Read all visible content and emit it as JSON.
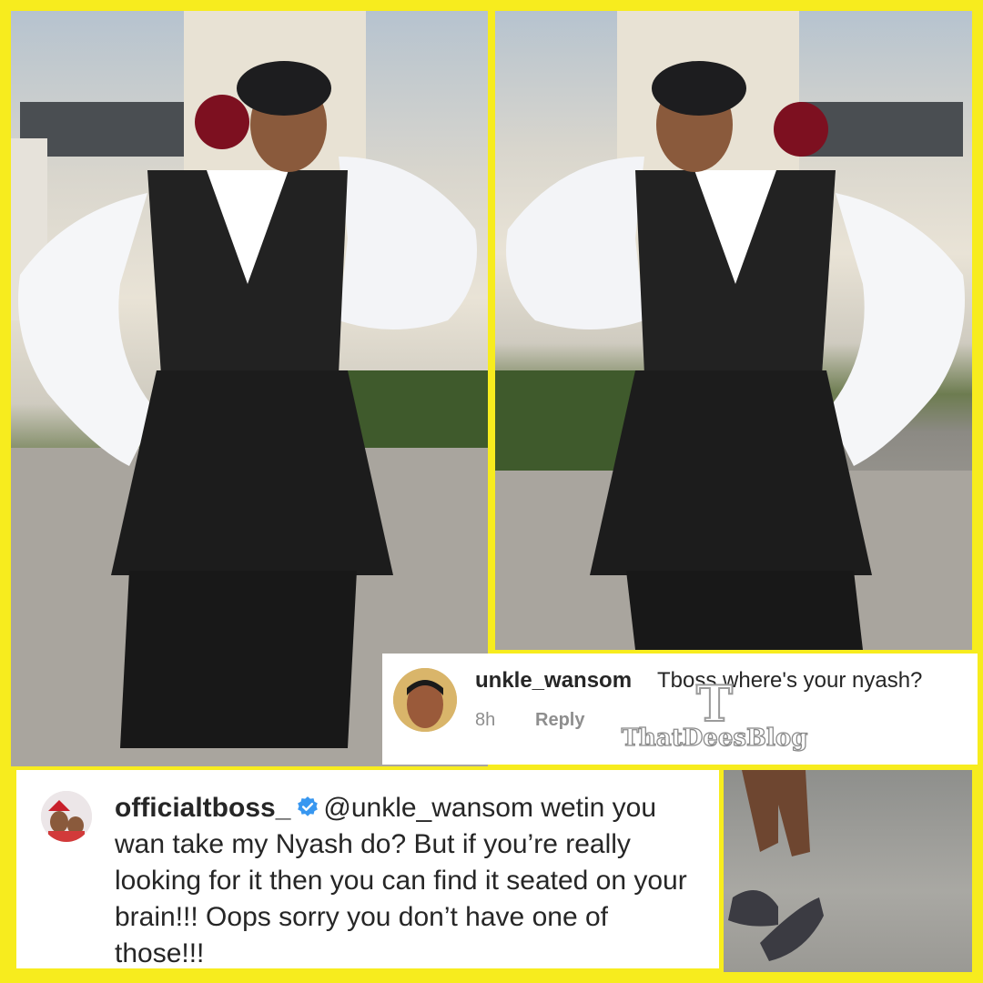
{
  "top_comment": {
    "username": "unkle_wansom",
    "text": "Tboss where's your nyash?",
    "time": "8h",
    "reply_label": "Reply"
  },
  "watermark": {
    "letter": "T",
    "name": "ThatDeesBlog"
  },
  "bottom_comment": {
    "username": "officialtboss_",
    "verified": true,
    "text": "@unkle_wansom wetin you wan take my Nyash do? But if you’re really looking for it then you can find it seated on your brain!!! Oops sorry you don’t have one of those!!!"
  },
  "colors": {
    "frame": "#f7ec1e",
    "verified_badge": "#3897f0",
    "username_text": "#262626",
    "meta_text": "#8e8e8e"
  }
}
